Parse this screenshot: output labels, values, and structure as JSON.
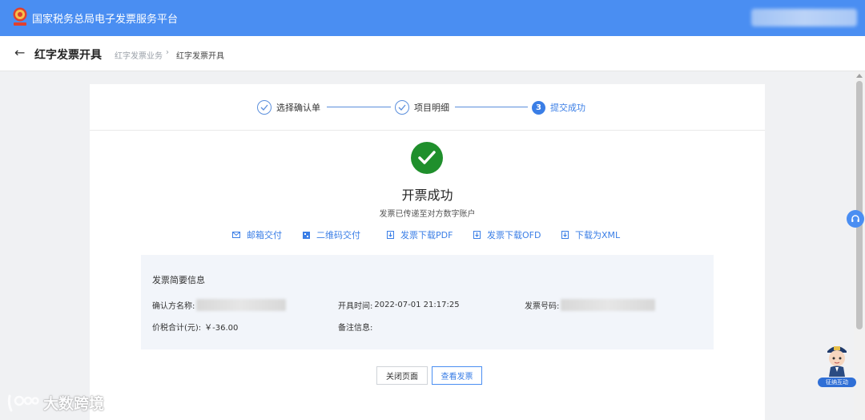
{
  "header": {
    "app_title": "国家税务总局电子发票服务平台",
    "logo_icon": "tax-emblem-icon"
  },
  "subheader": {
    "title": "红字发票开具",
    "breadcrumb": [
      "红字发票业务",
      "红字发票开具"
    ]
  },
  "steps": [
    {
      "label": "选择确认单",
      "status": "done"
    },
    {
      "label": "项目明细",
      "status": "done"
    },
    {
      "label": "提交成功",
      "number": "3",
      "status": "active"
    }
  ],
  "result": {
    "title": "开票成功",
    "subtitle": "发票已传递至对方数字账户"
  },
  "actions": [
    {
      "label": "邮箱交付",
      "icon": "mail-icon"
    },
    {
      "label": "二维码交付",
      "icon": "qrcode-icon"
    },
    {
      "label": "发票下载PDF",
      "icon": "download-pdf-icon"
    },
    {
      "label": "发票下载OFD",
      "icon": "download-ofd-icon"
    },
    {
      "label": "下载为XML",
      "icon": "download-xml-icon"
    }
  ],
  "info": {
    "title": "发票简要信息",
    "buyer_label": "确认方名称:",
    "issue_time_label": "开具时间:",
    "issue_time": "2022-07-01 21:17:25",
    "invoice_no_label": "发票号码:",
    "total_label": "价税合计(元):",
    "total_value": "￥-36.00",
    "remark_label": "备注信息:"
  },
  "buttons": {
    "close": "关闭页面",
    "view": "查看发票"
  },
  "assistant": {
    "label": "征纳互动"
  },
  "watermark": {
    "text": "大数跨境"
  },
  "colors": {
    "brand_blue": "#4a8ef2",
    "success_green": "#1f8f2c",
    "link_blue": "#3a7ee6"
  }
}
